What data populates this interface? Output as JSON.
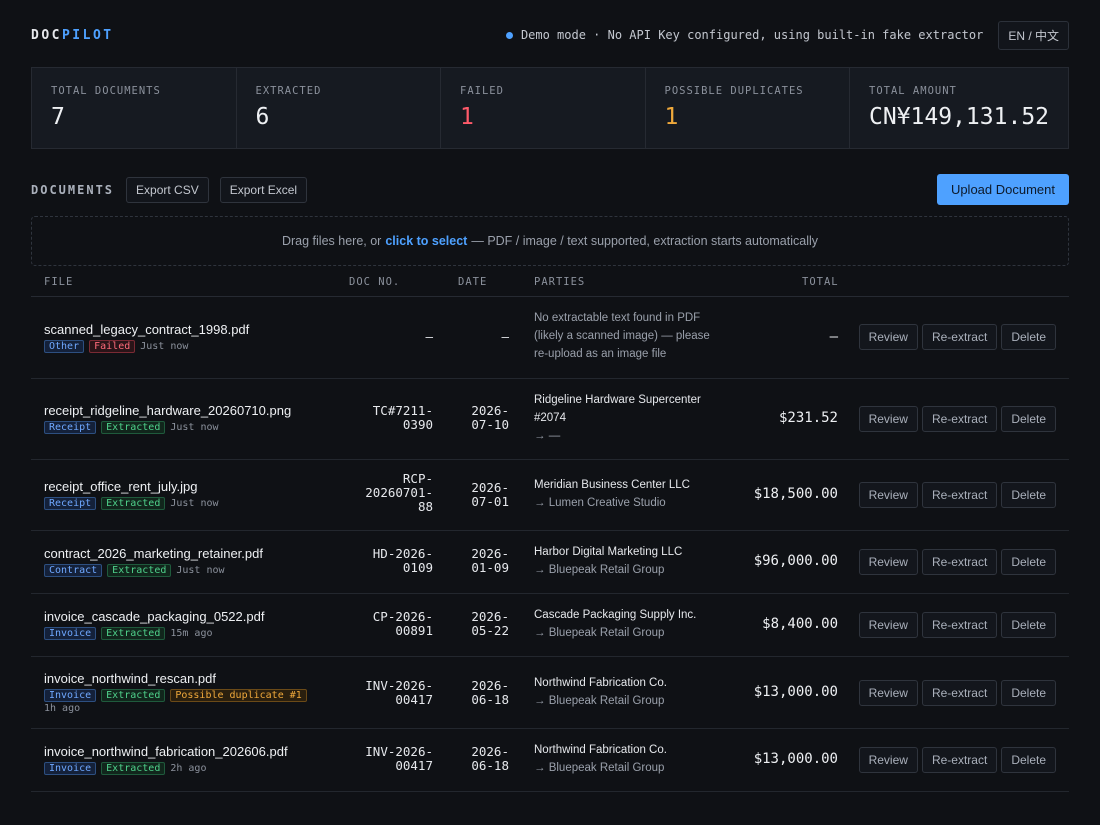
{
  "header": {
    "logo_part1": "DOC",
    "logo_part2": "PILOT",
    "status_text": "Demo mode · No API Key configured, using built-in fake extractor",
    "lang_toggle": "EN / 中文"
  },
  "stats": [
    {
      "label": "TOTAL DOCUMENTS",
      "value": "7"
    },
    {
      "label": "EXTRACTED",
      "value": "6"
    },
    {
      "label": "FAILED",
      "value": "1"
    },
    {
      "label": "POSSIBLE DUPLICATES",
      "value": "1"
    },
    {
      "label": "TOTAL AMOUNT",
      "value": "CN¥149,131.52"
    }
  ],
  "documents": {
    "title": "DOCUMENTS",
    "export_csv": "Export CSV",
    "export_excel": "Export Excel",
    "upload": "Upload Document"
  },
  "dropzone": {
    "before": "Drag files here, or",
    "link": "click to select",
    "after": "— PDF / image / text supported, extraction starts automatically"
  },
  "table": {
    "columns": [
      "FILE",
      "DOC NO.",
      "DATE",
      "PARTIES",
      "TOTAL"
    ],
    "actions": {
      "review": "Review",
      "reextract": "Re-extract",
      "delete": "Delete"
    },
    "rows": [
      {
        "file": "scanned_legacy_contract_1998.pdf",
        "type": "Other",
        "status": "Failed",
        "time": "Just now",
        "doc_no": [
          "—"
        ],
        "date": [
          "—"
        ],
        "parties_note": [
          "No extractable text found in PDF",
          "(likely a scanned image) — please",
          "re-upload as an image file"
        ],
        "total": "—"
      },
      {
        "file": "receipt_ridgeline_hardware_20260710.png",
        "type": "Receipt",
        "status": "Extracted",
        "time": "Just now",
        "doc_no": [
          "TC#7211-",
          "0390"
        ],
        "date": [
          "2026-",
          "07-10"
        ],
        "party_from": [
          "Ridgeline Hardware Supercenter",
          "#2074"
        ],
        "party_to": "→ —",
        "total": "$231.52"
      },
      {
        "file": "receipt_office_rent_july.jpg",
        "type": "Receipt",
        "status": "Extracted",
        "time": "Just now",
        "doc_no": [
          "RCP-",
          "20260701-",
          "88"
        ],
        "date": [
          "2026-",
          "07-01"
        ],
        "party_from": [
          "Meridian Business Center LLC"
        ],
        "party_to": "→ Lumen Creative Studio",
        "total": "$18,500.00"
      },
      {
        "file": "contract_2026_marketing_retainer.pdf",
        "type": "Contract",
        "status": "Extracted",
        "time": "Just now",
        "doc_no": [
          "HD-2026-",
          "0109"
        ],
        "date": [
          "2026-",
          "01-09"
        ],
        "party_from": [
          "Harbor Digital Marketing LLC"
        ],
        "party_to": "→ Bluepeak Retail Group",
        "total": "$96,000.00"
      },
      {
        "file": "invoice_cascade_packaging_0522.pdf",
        "type": "Invoice",
        "status": "Extracted",
        "time": "15m ago",
        "doc_no": [
          "CP-2026-",
          "00891"
        ],
        "date": [
          "2026-",
          "05-22"
        ],
        "party_from": [
          "Cascade Packaging Supply Inc."
        ],
        "party_to": "→ Bluepeak Retail Group",
        "total": "$8,400.00"
      },
      {
        "file": "invoice_northwind_rescan.pdf",
        "type": "Invoice",
        "status": "Extracted",
        "duplicate": "Possible duplicate #1",
        "time": "1h ago",
        "doc_no": [
          "INV-2026-",
          "00417"
        ],
        "date": [
          "2026-",
          "06-18"
        ],
        "party_from": [
          "Northwind Fabrication Co."
        ],
        "party_to": "→ Bluepeak Retail Group",
        "total": "$13,000.00"
      },
      {
        "file": "invoice_northwind_fabrication_202606.pdf",
        "type": "Invoice",
        "status": "Extracted",
        "time": "2h ago",
        "doc_no": [
          "INV-2026-",
          "00417"
        ],
        "date": [
          "2026-",
          "06-18"
        ],
        "party_from": [
          "Northwind Fabrication Co."
        ],
        "party_to": "→ Bluepeak Retail Group",
        "total": "$13,000.00"
      }
    ]
  }
}
